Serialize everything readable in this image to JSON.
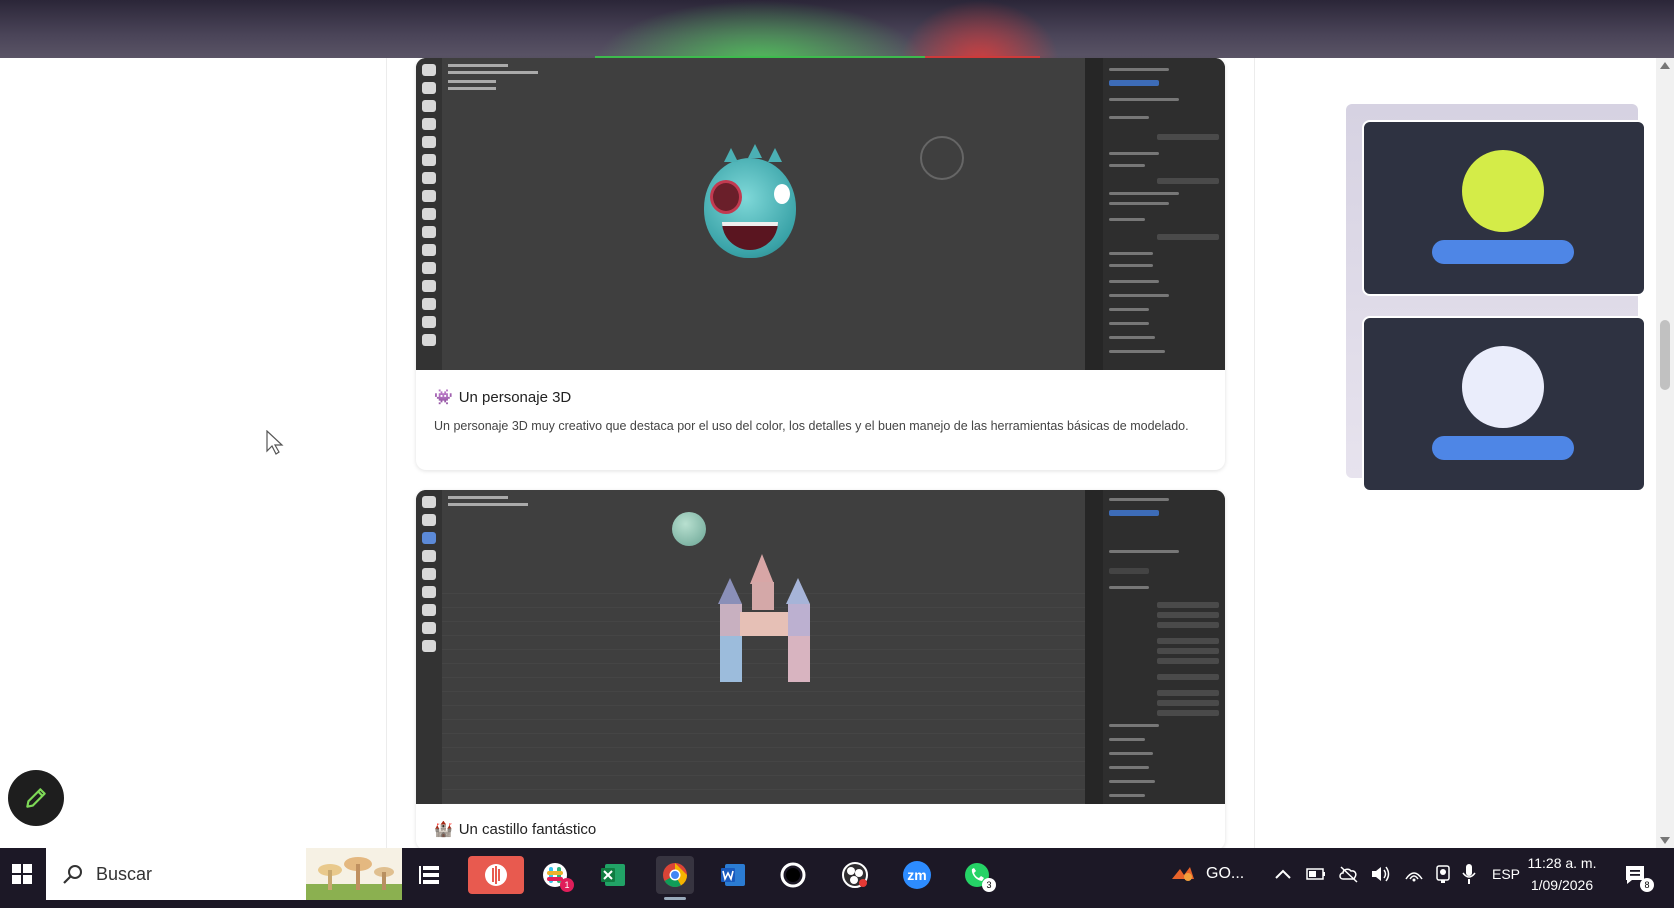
{
  "cards": [
    {
      "emoji": "👾",
      "title": "Un personaje 3D",
      "description": "Un personaje 3D muy creativo que destaca por el uso del color, los detalles y el buen manejo de las herramientas básicas de modelado."
    },
    {
      "emoji": "🏰",
      "title": "Un castillo fantástico"
    }
  ],
  "taskbar": {
    "search_label": "Buscar",
    "apps": [
      {
        "name": "task-view-icon"
      },
      {
        "name": "podcast-app-icon"
      },
      {
        "name": "slack-icon",
        "badge": "1"
      },
      {
        "name": "excel-icon"
      },
      {
        "name": "chrome-icon"
      },
      {
        "name": "word-icon"
      },
      {
        "name": "cortana-icon"
      },
      {
        "name": "obs-icon"
      },
      {
        "name": "zoom-icon",
        "label": "zm"
      },
      {
        "name": "whatsapp-icon",
        "badge": "3"
      }
    ],
    "tray_app_label": "GO...",
    "language": "ESP",
    "time": "11:28 a. m.",
    "date": "1/09/2026",
    "notification_count": "8"
  },
  "colors": {
    "avatar_1": "#d4ec48",
    "avatar_2": "#eaedfb",
    "name_bar": "#4e86e6",
    "taskbar": "#1c1826"
  }
}
